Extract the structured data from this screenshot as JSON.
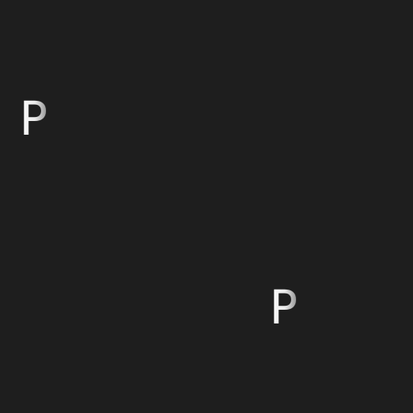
{
  "background_color": "#1e1e1e",
  "text_color": "#f2f2f2",
  "glyphs": [
    {
      "text": "P"
    },
    {
      "text": "P"
    }
  ]
}
